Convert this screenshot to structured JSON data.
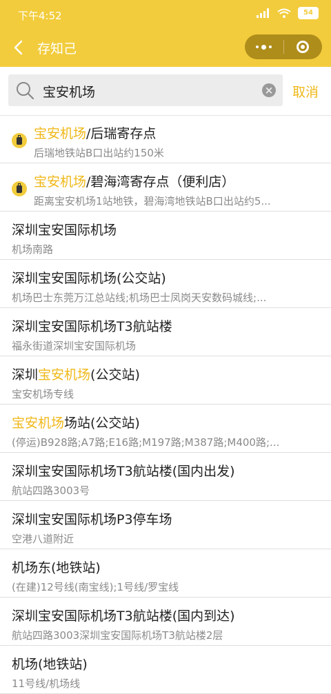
{
  "status_bar": {
    "time": "下午4:52",
    "signal_icon": "signal-bars-icon",
    "wifi_icon": "wifi-icon",
    "battery_level": "54"
  },
  "nav": {
    "title": "存知己",
    "back_icon": "chevron-left-icon",
    "more_icon": "more-dots-icon",
    "close_icon": "target-icon"
  },
  "search": {
    "query": "宝安机场",
    "cancel_label": "取消"
  },
  "results": [
    {
      "hl": "宝安机场",
      "rest": "/后瑞寄存点",
      "sub": "后瑞地铁站B口出站约150米",
      "icon": "luggage-pin-icon"
    },
    {
      "hl": "宝安机场",
      "rest": "/碧海湾寄存点（便利店）",
      "sub": "距离宝安机场1站地铁，碧海湾地铁站B口出站约5...",
      "icon": "luggage-pin-icon"
    },
    {
      "title": "深圳宝安国际机场",
      "sub": "机场南路"
    },
    {
      "title": "深圳宝安国际机场(公交站)",
      "sub": "机场巴士东莞万江总站线;机场巴士凤岗天安数码城线;..."
    },
    {
      "title": "深圳宝安国际机场T3航站楼",
      "sub": "福永街道深圳宝安国际机场"
    },
    {
      "pre": "深圳",
      "hl": "宝安机场",
      "rest": "(公交站)",
      "sub": "宝安机场专线"
    },
    {
      "hl": "宝安机场",
      "rest": "场站(公交站)",
      "sub": "(停运)B928路;A7路;E16路;M197路;M387路;M400路;..."
    },
    {
      "title": "深圳宝安国际机场T3航站楼(国内出发)",
      "sub": "航站四路3003号"
    },
    {
      "title": "深圳宝安国际机场P3停车场",
      "sub": "空港八道附近"
    },
    {
      "title": "机场东(地铁站)",
      "sub": "(在建)12号线(南宝线);1号线/罗宝线"
    },
    {
      "title": "深圳宝安国际机场T3航站楼(国内到达)",
      "sub": "航站四路3003深圳宝安国际机场T3航站楼2层"
    },
    {
      "title": "机场(地铁站)",
      "sub": "11号线/机场线"
    }
  ]
}
